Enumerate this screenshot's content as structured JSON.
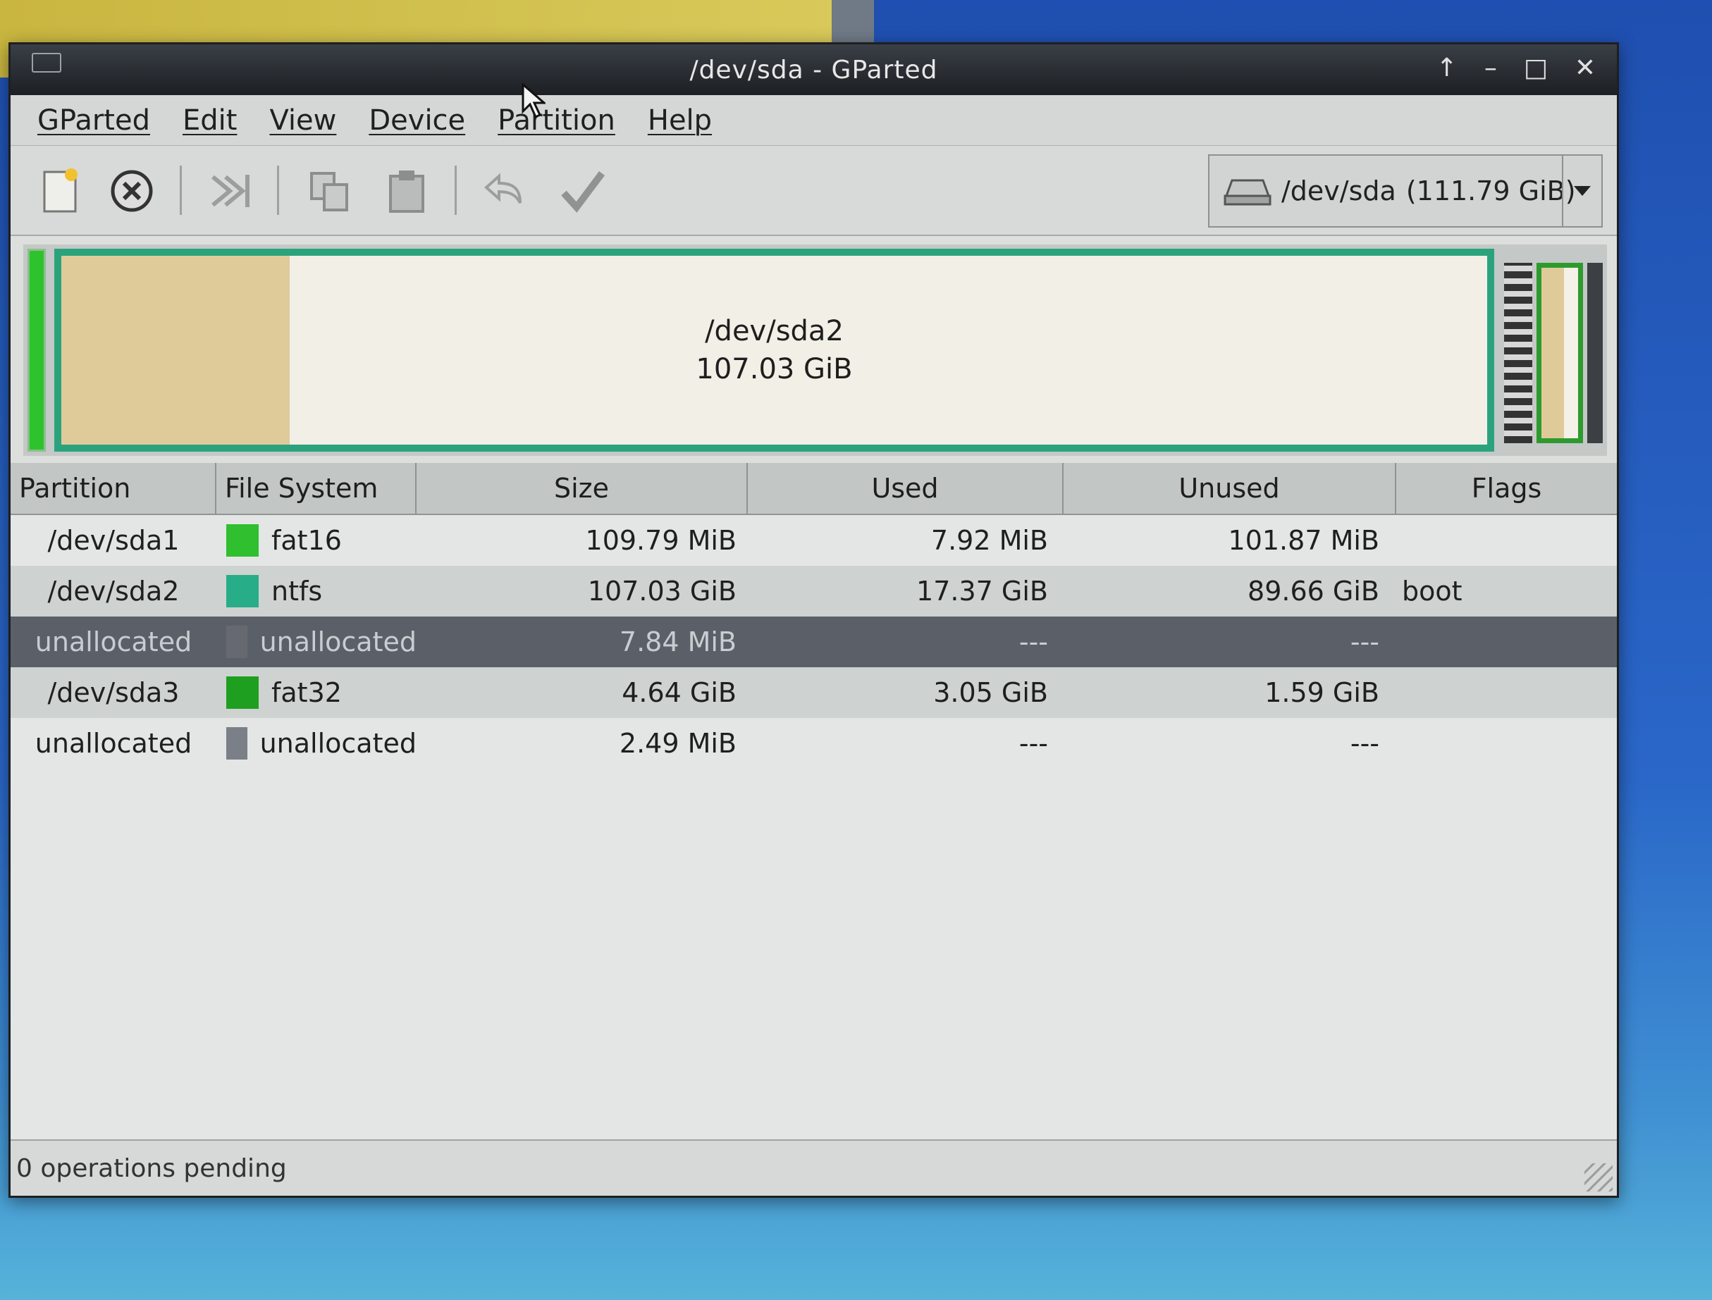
{
  "window": {
    "title": "/dev/sda - GParted",
    "controls": [
      "↑",
      "–",
      "□",
      "✕"
    ]
  },
  "menu": {
    "items": [
      "GParted",
      "Edit",
      "View",
      "Device",
      "Partition",
      "Help"
    ]
  },
  "toolbar": {
    "buttons": [
      "new-icon",
      "delete-icon",
      "resize-move-icon",
      "copy-icon",
      "paste-icon",
      "undo-icon",
      "apply-icon"
    ]
  },
  "device": {
    "name": "/dev/sda",
    "size": "(111.79 GiB)"
  },
  "diskmap": {
    "selected_name": "/dev/sda2",
    "selected_size": "107.03 GiB"
  },
  "table": {
    "headers": [
      "Partition",
      "File System",
      "Size",
      "Used",
      "Unused",
      "Flags"
    ],
    "rows": [
      {
        "partition": "/dev/sda1",
        "fs": "fat16",
        "color": "#2fbf2f",
        "size": "109.79 MiB",
        "used": "7.92 MiB",
        "unused": "101.87 MiB",
        "flags": ""
      },
      {
        "partition": "/dev/sda2",
        "fs": "ntfs",
        "color": "#27ad88",
        "size": "107.03 GiB",
        "used": "17.37 GiB",
        "unused": "89.66 GiB",
        "flags": "boot"
      },
      {
        "partition": "unallocated",
        "fs": "unallocated",
        "color": "#666a70",
        "size": "7.84 MiB",
        "used": "---",
        "unused": "---",
        "flags": ""
      },
      {
        "partition": "/dev/sda3",
        "fs": "fat32",
        "color": "#1f9f1f",
        "size": "4.64 GiB",
        "used": "3.05 GiB",
        "unused": "1.59 GiB",
        "flags": ""
      },
      {
        "partition": "unallocated",
        "fs": "unallocated",
        "color": "#7b7f88",
        "size": "2.49 MiB",
        "used": "---",
        "unused": "---",
        "flags": ""
      }
    ]
  },
  "status": {
    "text": "0 operations pending"
  }
}
